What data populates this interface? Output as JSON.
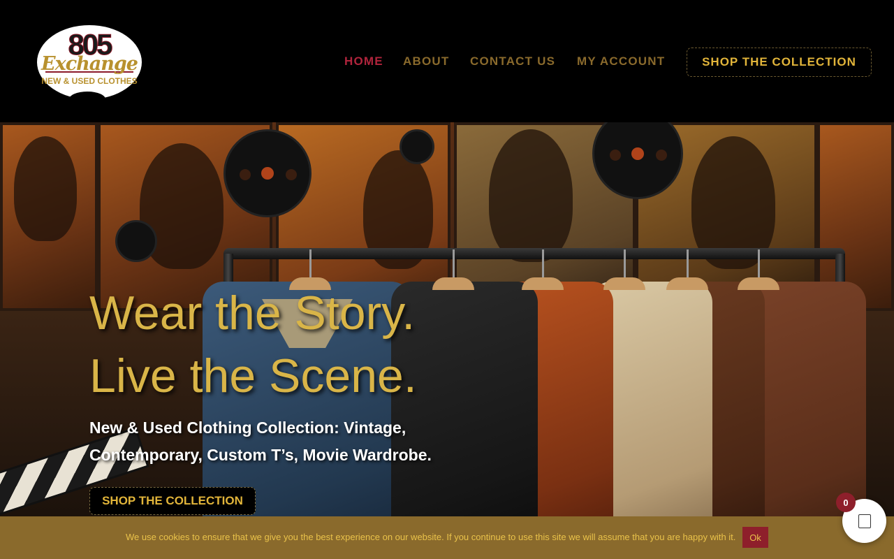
{
  "logo": {
    "number": "805",
    "word": "Exchange",
    "tagline": "NEW & USED CLOTHES"
  },
  "nav": {
    "items": [
      {
        "label": "HOME",
        "active": true
      },
      {
        "label": "ABOUT",
        "active": false
      },
      {
        "label": "CONTACT US",
        "active": false
      },
      {
        "label": "MY ACCOUNT",
        "active": false
      }
    ],
    "cta_label": "SHOP THE COLLECTION"
  },
  "hero": {
    "title_line1": "Wear the Story.",
    "title_line2": "Live the Scene.",
    "subtitle_line1": "New & Used Clothing Collection: Vintage,",
    "subtitle_line2": "Contemporary, Custom T’s, Movie Wardrobe.",
    "cta_label": "SHOP THE COLLECTION"
  },
  "cookie": {
    "message": "We use cookies to ensure that we give you the best experience on our website. If you continue to use this site we will assume that you are happy with it.",
    "ok_label": "Ok"
  },
  "cart": {
    "count": "0",
    "icon": "shopping-bag-icon"
  },
  "colors": {
    "header_bg": "#000000",
    "nav_text": "#8a6a2c",
    "nav_active": "#b0243c",
    "gold_accent": "#e2b53a",
    "cookie_bg": "#8a6a2c",
    "ok_button": "#8e1f2b"
  }
}
